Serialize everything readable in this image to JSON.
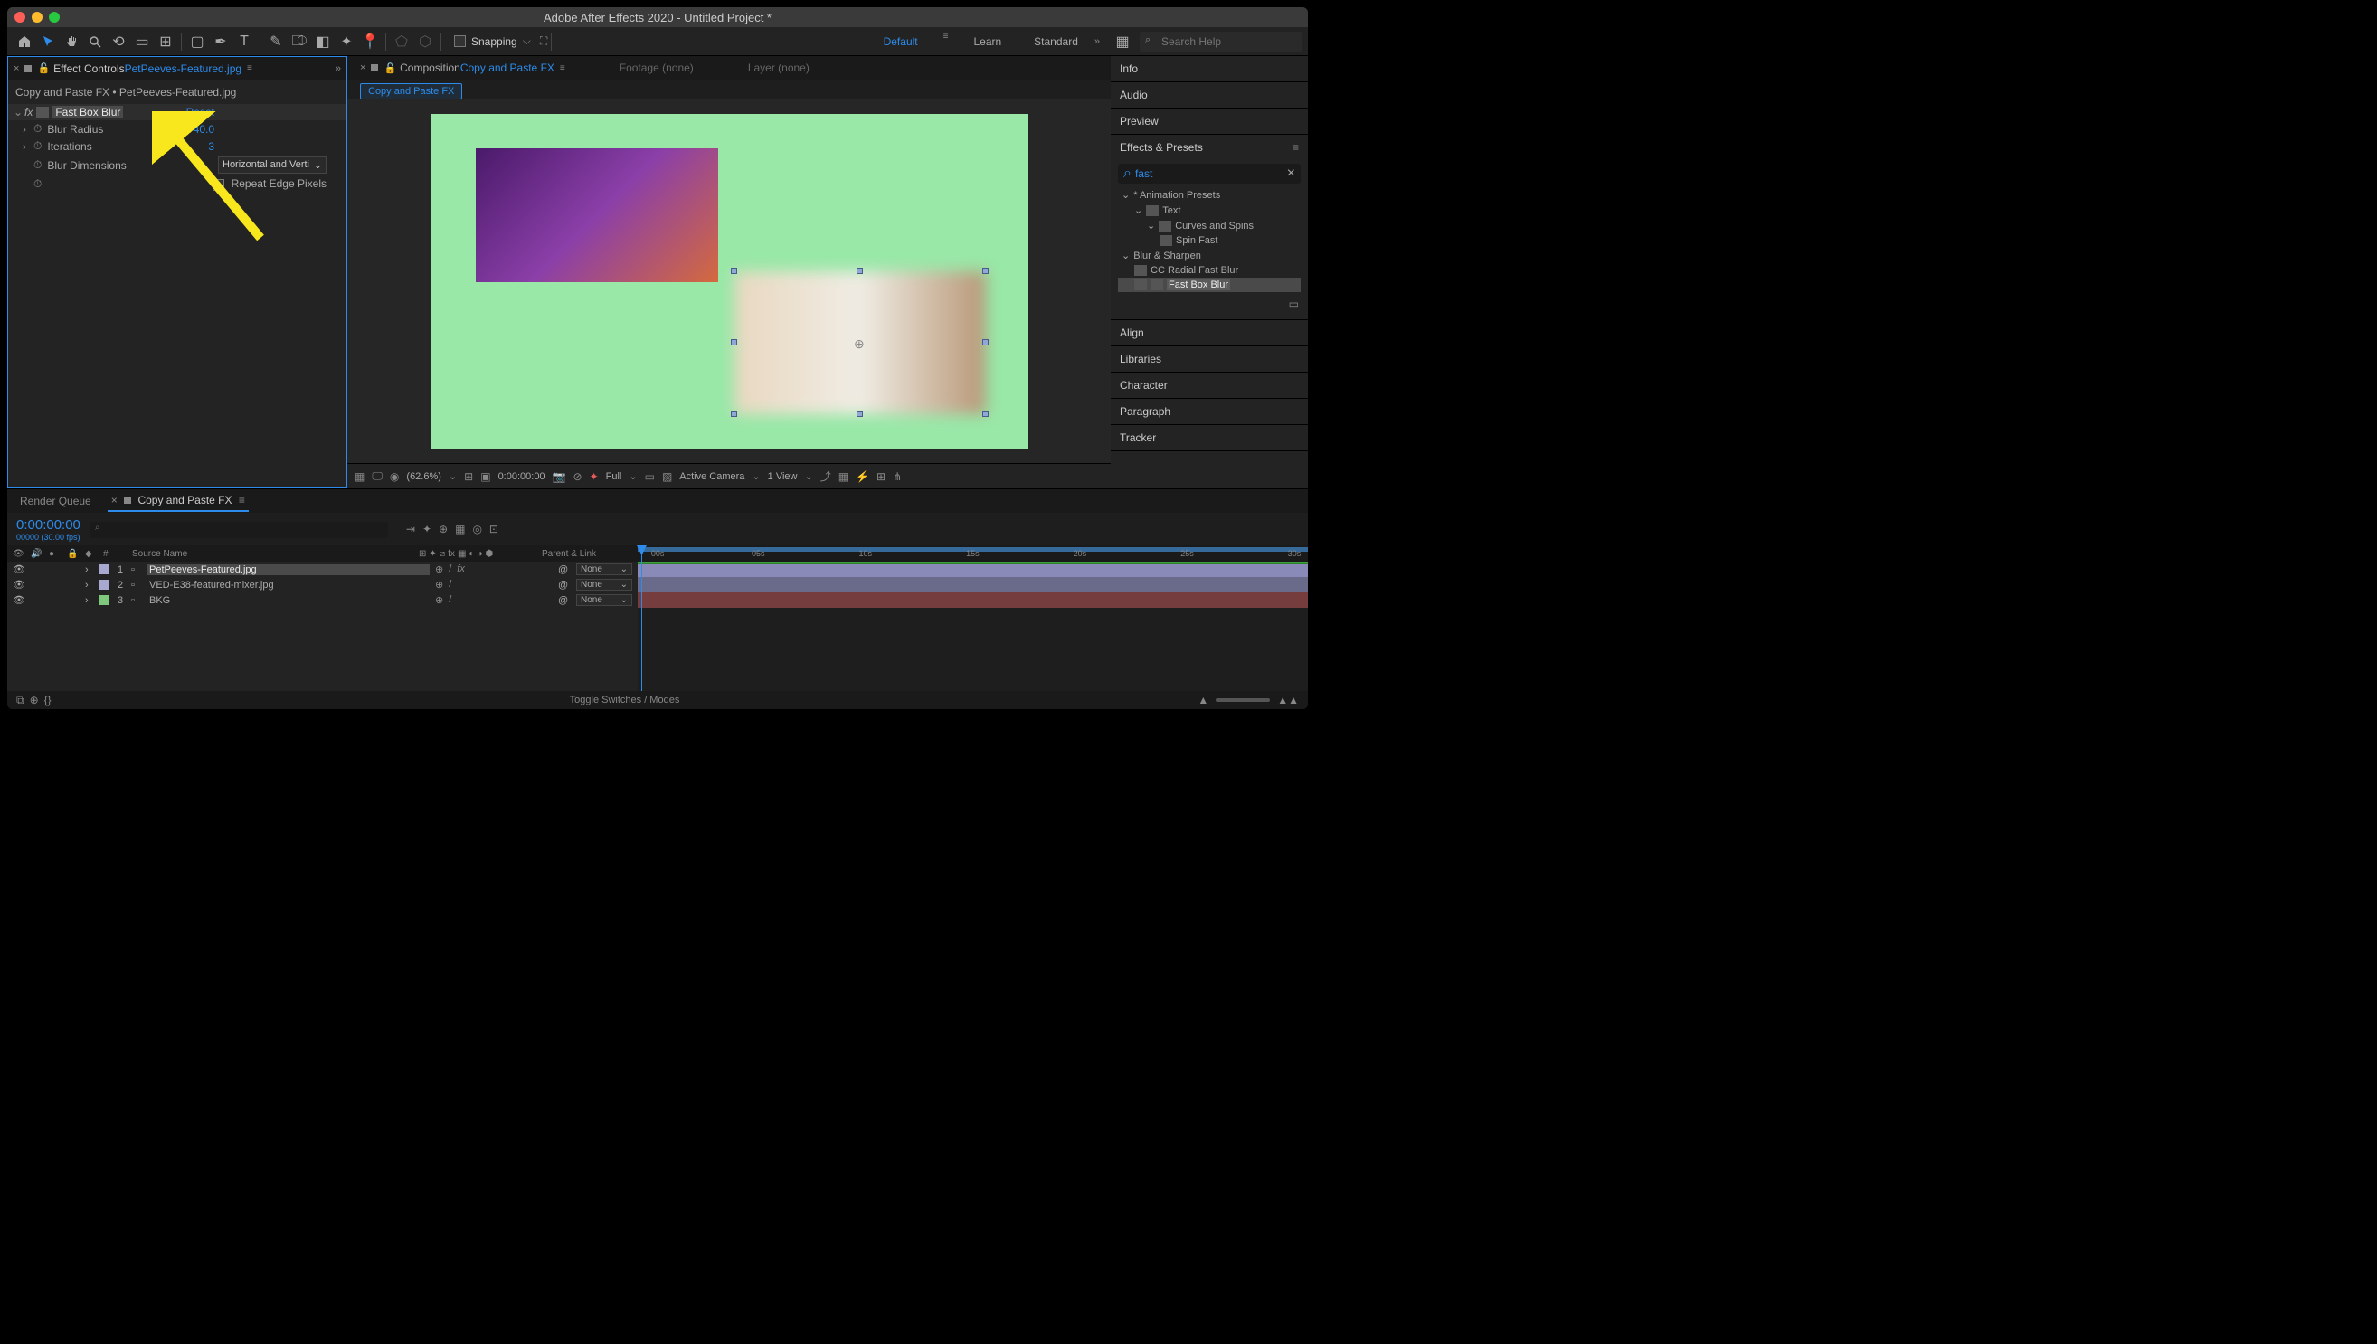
{
  "title": "Adobe After Effects 2020 - Untitled Project *",
  "toolbar": {
    "snapping_label": "Snapping"
  },
  "workspaces": {
    "default": "Default",
    "learn": "Learn",
    "standard": "Standard"
  },
  "search_help_placeholder": "Search Help",
  "effect_controls": {
    "tab_prefix": "Effect Controls ",
    "tab_file": "PetPeeves-Featured.jpg",
    "breadcrumb": "Copy and Paste FX • PetPeeves-Featured.jpg",
    "effect_name": "Fast Box Blur",
    "reset": "Reset",
    "props": {
      "blur_radius_label": "Blur Radius",
      "blur_radius_val": "40.0",
      "iterations_label": "Iterations",
      "iterations_val": "3",
      "blur_dimensions_label": "Blur Dimensions",
      "blur_dimensions_val": "Horizontal and Verti",
      "repeat_edge_label": "Repeat Edge Pixels"
    }
  },
  "composition": {
    "tab_prefix": "Composition ",
    "tab_name": "Copy and Paste FX",
    "footage": "Footage (none)",
    "layer": "Layer (none)",
    "chip": "Copy and Paste FX"
  },
  "viewer_footer": {
    "zoom": "(62.6%)",
    "time": "0:00:00:00",
    "resolution": "Full",
    "camera": "Active Camera",
    "view": "1 View"
  },
  "right_panel": {
    "info": "Info",
    "audio": "Audio",
    "preview": "Preview",
    "effects_presets": "Effects & Presets",
    "search_value": "fast",
    "tree": {
      "animation_presets": "* Animation Presets",
      "text": "Text",
      "curves_spins": "Curves and Spins",
      "spin_fast": "Spin Fast",
      "blur_sharpen": "Blur & Sharpen",
      "cc_radial": "CC Radial Fast Blur",
      "fast_box_blur": "Fast Box Blur"
    },
    "align": "Align",
    "libraries": "Libraries",
    "character": "Character",
    "paragraph": "Paragraph",
    "tracker": "Tracker"
  },
  "bottom": {
    "render_queue": "Render Queue",
    "comp_tab": "Copy and Paste FX",
    "timecode": "0:00:00:00",
    "fps": "00000 (30.00 fps)",
    "col_num": "#",
    "col_source": "Source Name",
    "col_parent": "Parent & Link",
    "layers": [
      {
        "num": "1",
        "color": "#a8a8d0",
        "name": "PetPeeves-Featured.jpg",
        "parent": "None"
      },
      {
        "num": "2",
        "color": "#a8a8d0",
        "name": "VED-E38-featured-mixer.jpg",
        "parent": "None"
      },
      {
        "num": "3",
        "color": "#7ec87e",
        "name": "BKG",
        "parent": "None"
      }
    ],
    "ruler_ticks": [
      "00s",
      "05s",
      "10s",
      "15s",
      "20s",
      "25s",
      "30s"
    ],
    "toggle_switches": "Toggle Switches / Modes"
  }
}
